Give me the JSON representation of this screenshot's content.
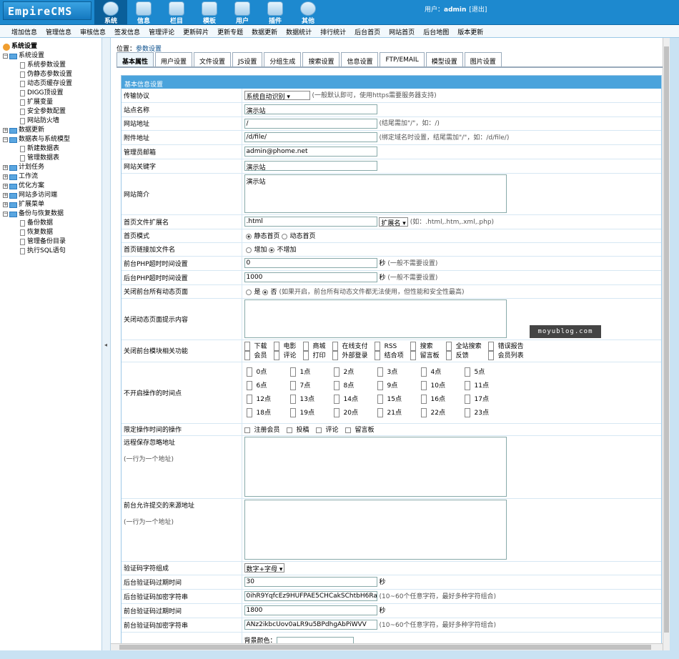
{
  "logo": {
    "text": "EmpireCMS"
  },
  "mainnav": [
    {
      "label": "系统",
      "icon": "globe-icon"
    },
    {
      "label": "信息",
      "icon": "pencil-doc-icon"
    },
    {
      "label": "栏目",
      "icon": "folder-icon"
    },
    {
      "label": "模板",
      "icon": "template-icon"
    },
    {
      "label": "用户",
      "icon": "user-icon"
    },
    {
      "label": "插件",
      "icon": "plugin-icon"
    },
    {
      "label": "其他",
      "icon": "gear-icon"
    }
  ],
  "user": {
    "prefix": "用户：",
    "name": "admin",
    "logout": "[退出]"
  },
  "subnav": [
    "增加信息",
    "管理信息",
    "审核信息",
    "签发信息",
    "管理评论",
    "更新碎片",
    "更新专题",
    "数据更新",
    "数据统计",
    "排行统计",
    "后台首页",
    "网站首页",
    "后台地图",
    "版本更新"
  ],
  "tree": {
    "root": "系统设置",
    "groups": [
      {
        "label": "系统设置",
        "open": true,
        "children": [
          "系统参数设置",
          "伪静态参数设置",
          "动态页缓存设置",
          "DIGG顶设置",
          "扩展变量",
          "安全参数配置",
          "网站防火墙"
        ]
      },
      {
        "label": "数据更新",
        "open": false,
        "children": []
      },
      {
        "label": "数据表与系统模型",
        "open": true,
        "children": [
          "新建数据表",
          "管理数据表"
        ]
      },
      {
        "label": "计划任务",
        "open": false,
        "children": []
      },
      {
        "label": "工作流",
        "open": false,
        "children": []
      },
      {
        "label": "优化方案",
        "open": false,
        "children": []
      },
      {
        "label": "网站多访问端",
        "open": false,
        "children": []
      },
      {
        "label": "扩展菜单",
        "open": false,
        "children": []
      },
      {
        "label": "备份与恢复数据",
        "open": true,
        "children": [
          "备份数据",
          "恢复数据",
          "管理备份目录",
          "执行SQL语句"
        ]
      }
    ]
  },
  "breadcrumb": {
    "prefix": "位置：",
    "link": "参数设置"
  },
  "tabs": [
    "基本属性",
    "用户设置",
    "文件设置",
    "JS设置",
    "分组生成",
    "搜索设置",
    "信息设置",
    "FTP/EMAIL",
    "模型设置",
    "图片设置"
  ],
  "form": {
    "header": "基本信息设置",
    "protocol": {
      "label": "传输协议",
      "value": "系统自动识别",
      "hint": "(一般默认即可，使用https需要服务器支持)"
    },
    "sitename": {
      "label": "站点名称",
      "value": "演示站"
    },
    "siteurl": {
      "label": "网站地址",
      "value": "/",
      "hint": "(结尾需加\"/\"，如：/)"
    },
    "fileurl": {
      "label": "附件地址",
      "value": "/d/file/",
      "hint": "(绑定域名时设置，结尾需加\"/\"，如：/d/file/)"
    },
    "email": {
      "label": "管理员邮箱",
      "value": "admin@phome.net"
    },
    "keywords": {
      "label": "网站关键字",
      "value": "演示站"
    },
    "intro": {
      "label": "网站简介",
      "value": "演示站"
    },
    "indexext": {
      "label": "首页文件扩展名",
      "value": ".html",
      "select": "扩展名",
      "hint": "(如：.html,.htm,.xml,.php)"
    },
    "indexmode": {
      "label": "首页模式",
      "opt1": "静态首页",
      "opt2": "动态首页"
    },
    "indexlink": {
      "label": "首页链接加文件名",
      "opt1": "增加",
      "opt2": "不增加"
    },
    "phptime": {
      "label": "前台PHP超时时间设置",
      "value": "0",
      "unit": "秒",
      "hint": "(一般不需要设置)"
    },
    "adminphptime": {
      "label": "后台PHP超时时间设置",
      "value": "1000",
      "unit": "秒",
      "hint": "(一般不需要设置)"
    },
    "closedyn": {
      "label": "关闭前台所有动态页面",
      "opt1": "是",
      "opt2": "否",
      "hint": "(如果开启，前台所有动态文件都无法使用，但性能和安全性最高)"
    },
    "closetip": {
      "label": "关闭动态页面提示内容"
    },
    "closemods": {
      "label": "关闭前台模块相关功能",
      "items": [
        "下载",
        "电影",
        "商城",
        "在线支付",
        "RSS",
        "搜索",
        "全站搜索",
        "错误报告",
        "会员",
        "评论",
        "打印",
        "外部登录",
        "结合项",
        "留言板",
        "反馈",
        "会员列表"
      ]
    },
    "closehours": {
      "label": "不开启操作的时间点",
      "items": [
        "0点",
        "1点",
        "2点",
        "3点",
        "4点",
        "5点",
        "6点",
        "7点",
        "8点",
        "9点",
        "10点",
        "11点",
        "12点",
        "13点",
        "14点",
        "15点",
        "16点",
        "17点",
        "18点",
        "19点",
        "20点",
        "21点",
        "22点",
        "23点"
      ]
    },
    "limitops": {
      "label": "限定操作时间的操作",
      "items": [
        "注册会员",
        "投稿",
        "评论",
        "留言板"
      ]
    },
    "remoteignore": {
      "label": "远程保存忽略地址",
      "sub": "(一行为一个地址)"
    },
    "allowsource": {
      "label": "前台允许提交的来源地址",
      "sub": "(一行为一个地址)"
    },
    "codechars": {
      "label": "验证码字符组成",
      "value": "数字+字母"
    },
    "admincodetime": {
      "label": "后台验证码过期时间",
      "value": "30",
      "unit": "秒"
    },
    "admincodekey": {
      "label": "后台验证码加密字符串",
      "value": "0ihR9YqfcEz9HUFPAE5CHCakSChtbH6RaeRy",
      "hint": "(10~60个任意字符，最好多种字符组合)"
    },
    "frontcodetime": {
      "label": "前台验证码过期时间",
      "value": "1800",
      "unit": "秒"
    },
    "frontcodekey": {
      "label": "前台验证码加密字符串",
      "value": "ANz2ikbcUov0aLR9u5BPdhgAbPiWVV",
      "hint": "(10~60个任意字符，最好多种字符组合)"
    },
    "bgcolor": {
      "label": "背景颜色："
    }
  },
  "watermark": "moyublog.com",
  "colors": {
    "topbar": "#1d89cf",
    "formhead": "#4aa3dc",
    "subnav": "#f2f8fc"
  }
}
